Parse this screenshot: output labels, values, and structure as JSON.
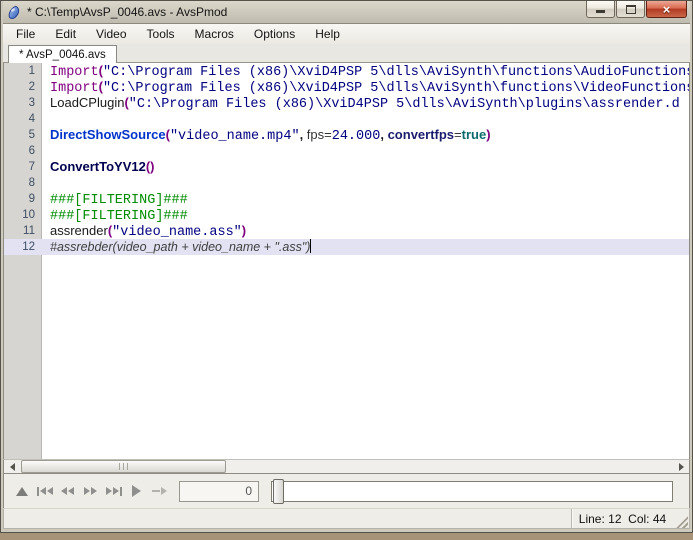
{
  "window": {
    "title": "* C:\\Temp\\AvsP_0046.avs - AvsPmod",
    "controls": [
      "minimize",
      "maximize",
      "close"
    ]
  },
  "menu_bar": {
    "items": [
      "File",
      "Edit",
      "Video",
      "Tools",
      "Macros",
      "Options",
      "Help"
    ]
  },
  "tab_bar": {
    "tabs": [
      {
        "label": "* AvsP_0046.avs",
        "active": true
      }
    ]
  },
  "editor": {
    "current_line": 12,
    "caret_at_end_of_current_line": true,
    "lines": [
      {
        "num": "1",
        "segments": [
          [
            "import",
            "Import"
          ],
          [
            "paren",
            "("
          ],
          [
            "string",
            "\"C:\\Program Files (x86)\\XviD4PSP 5\\dlls\\AviSynth\\functions\\AudioFunctions"
          ]
        ]
      },
      {
        "num": "2",
        "segments": [
          [
            "import",
            "Import"
          ],
          [
            "paren",
            "("
          ],
          [
            "string",
            "\"C:\\Program Files (x86)\\XviD4PSP 5\\dlls\\AviSynth\\functions\\VideoFunctions"
          ]
        ]
      },
      {
        "num": "3",
        "segments": [
          [
            "fn",
            "LoadCPlugin"
          ],
          [
            "paren",
            "("
          ],
          [
            "string",
            "\"C:\\Program Files (x86)\\XviD4PSP 5\\dlls\\AviSynth\\plugins\\assrender.d"
          ]
        ]
      },
      {
        "num": "4",
        "segments": []
      },
      {
        "num": "5",
        "segments": [
          [
            "source",
            "DirectShowSource"
          ],
          [
            "paren",
            "("
          ],
          [
            "string",
            "\"video_name.mp4\""
          ],
          [
            "comma",
            ", "
          ],
          [
            "arg",
            "fps"
          ],
          [
            "plain",
            "="
          ],
          [
            "number",
            "24.000"
          ],
          [
            "comma",
            ", "
          ],
          [
            "keyword",
            "convertfps"
          ],
          [
            "plain",
            "="
          ],
          [
            "boolean",
            "true"
          ],
          [
            "paren",
            ")"
          ]
        ]
      },
      {
        "num": "6",
        "segments": []
      },
      {
        "num": "7",
        "segments": [
          [
            "convert",
            "ConvertToYV12"
          ],
          [
            "paren",
            "()"
          ]
        ]
      },
      {
        "num": "8",
        "segments": []
      },
      {
        "num": "9",
        "segments": [
          [
            "marker",
            "###[FILTERING]###"
          ]
        ]
      },
      {
        "num": "10",
        "segments": [
          [
            "marker",
            "###[FILTERING]###"
          ]
        ]
      },
      {
        "num": "11",
        "segments": [
          [
            "fn",
            "assrender"
          ],
          [
            "paren",
            "("
          ],
          [
            "string",
            "\"video_name.ass\""
          ],
          [
            "paren",
            ")"
          ]
        ]
      },
      {
        "num": "12",
        "segments": [
          [
            "comment",
            "#assrebder(video_path + video_name + \".ass\")"
          ]
        ]
      }
    ]
  },
  "horizontal_scrollbar": {
    "thumb_position": "left",
    "thumb_fraction": 0.31
  },
  "video_toolbar": {
    "buttons": [
      {
        "name": "toggle-video-preview",
        "icon": "up-triangle"
      },
      {
        "name": "goto-first-frame",
        "icon": "skip-start"
      },
      {
        "name": "step-backward",
        "icon": "double-left"
      },
      {
        "name": "step-forward",
        "icon": "double-right"
      },
      {
        "name": "goto-last-frame",
        "icon": "skip-end"
      },
      {
        "name": "play",
        "icon": "play"
      },
      {
        "name": "goto-frame",
        "icon": "arrow-right"
      }
    ],
    "frame_input": {
      "value": "0"
    },
    "slider": {
      "position": 0
    }
  },
  "status_bar": {
    "line_col": "Line: 12  Col: 44"
  },
  "syntax_colors": {
    "import": "#800080",
    "string": "#000080",
    "paren": "#800080",
    "source_filter": "#0033cc",
    "core_filter": "#000050",
    "keyword_arg": "#1b1b6e",
    "boolean": "#0e6b6b",
    "number": "#000080",
    "section_marker": "#008c00",
    "comment": "#404040",
    "current_line_bg": "#e2e2f2"
  }
}
